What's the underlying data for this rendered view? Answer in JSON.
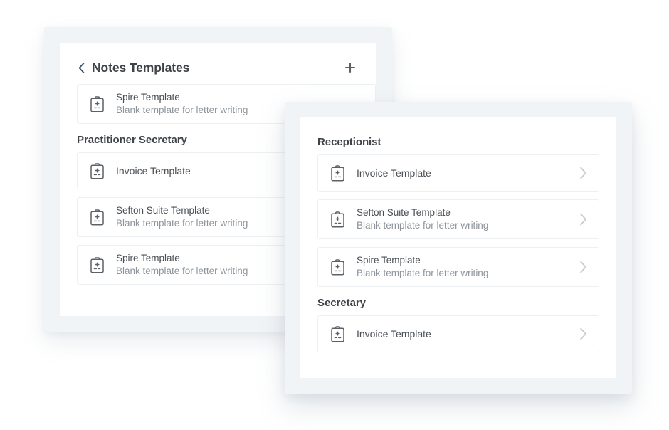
{
  "theme": {
    "page_background": "#ffffff",
    "card_frame": "#f1f4f6",
    "card_surface": "#ffffff",
    "row_border": "#edf0f2",
    "title_text": "#3f4348",
    "body_text": "#4a4f55",
    "muted_text": "#8d949b",
    "chevron": "#c4cbd2",
    "back_arrow": "#3d4f66"
  },
  "back_panel": {
    "header": {
      "back_icon": "chevron-left-icon",
      "title": "Notes Templates",
      "add_icon": "plus-icon"
    },
    "items": [
      {
        "icon": "clipboard-medical-icon",
        "title": "Spire Template",
        "subtitle": "Blank template for letter writing"
      }
    ],
    "sections": [
      {
        "heading": "Practitioner Secretary",
        "items": [
          {
            "icon": "clipboard-medical-icon",
            "title": "Invoice Template",
            "subtitle": ""
          },
          {
            "icon": "clipboard-medical-icon",
            "title": "Sefton Suite Template",
            "subtitle": "Blank template for letter writing"
          },
          {
            "icon": "clipboard-medical-icon",
            "title": "Spire Template",
            "subtitle": "Blank template for letter writing"
          }
        ]
      }
    ]
  },
  "front_panel": {
    "sections": [
      {
        "heading": "Receptionist",
        "items": [
          {
            "icon": "clipboard-medical-icon",
            "title": "Invoice Template",
            "subtitle": "",
            "chevron": "chevron-right-icon"
          },
          {
            "icon": "clipboard-medical-icon",
            "title": "Sefton Suite Template",
            "subtitle": "Blank template for letter writing",
            "chevron": "chevron-right-icon"
          },
          {
            "icon": "clipboard-medical-icon",
            "title": "Spire Template",
            "subtitle": "Blank template for letter writing",
            "chevron": "chevron-right-icon"
          }
        ]
      },
      {
        "heading": "Secretary",
        "items": [
          {
            "icon": "clipboard-medical-icon",
            "title": "Invoice Template",
            "subtitle": "",
            "chevron": "chevron-right-icon"
          }
        ]
      }
    ]
  }
}
